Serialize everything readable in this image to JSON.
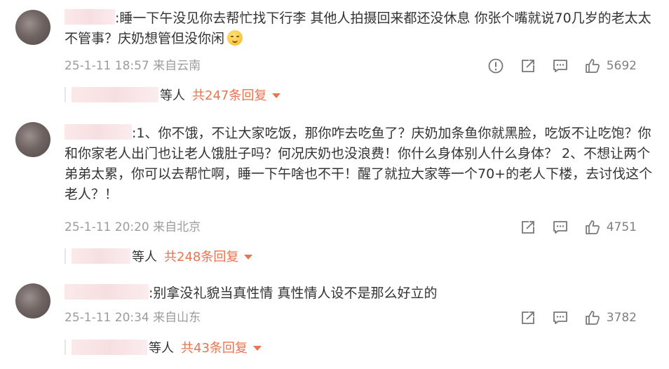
{
  "comments": [
    {
      "text": ":睡一下午没见你去帮忙找下行李 其他人拍摄回来都还没休息 你张个嘴就说70几岁的老太太不管事？庆奶想管但没你闲",
      "emoji_icon": "sleepy-face-emoji",
      "time": "25-1-11 18:57",
      "source": "来自云南",
      "likes": "5692",
      "reply_suffix": "等人",
      "reply_count": "共247条回复"
    },
    {
      "text": ":1、你不饿，不让大家吃饭，那你咋去吃鱼了？庆奶加条鱼你就黑脸，吃饭不让吃饱？你和你家老人出门也让老人饿肚子吗？何况庆奶也没浪费！你什么身体别人什么身体？ 2、不想让两个弟弟太累，你可以去帮忙啊，睡一下午啥也不干！醒了就拉大家等一个70+的老人下楼，去讨伐这个老人？！",
      "time": "25-1-11 20:20",
      "source": "来自北京",
      "likes": "4751",
      "reply_suffix": "等人",
      "reply_count": "共248条回复"
    },
    {
      "text": ":别拿没礼貌当真性情  真性情人设不是那么好立的",
      "time": "25-1-11 20:34",
      "source": "来自山东",
      "likes": "3782",
      "reply_suffix": "等人",
      "reply_count": "共43条回复"
    }
  ],
  "colors": {
    "accent": "#eb7350",
    "meta_text": "#9c9c9c",
    "body_text": "#333333"
  }
}
